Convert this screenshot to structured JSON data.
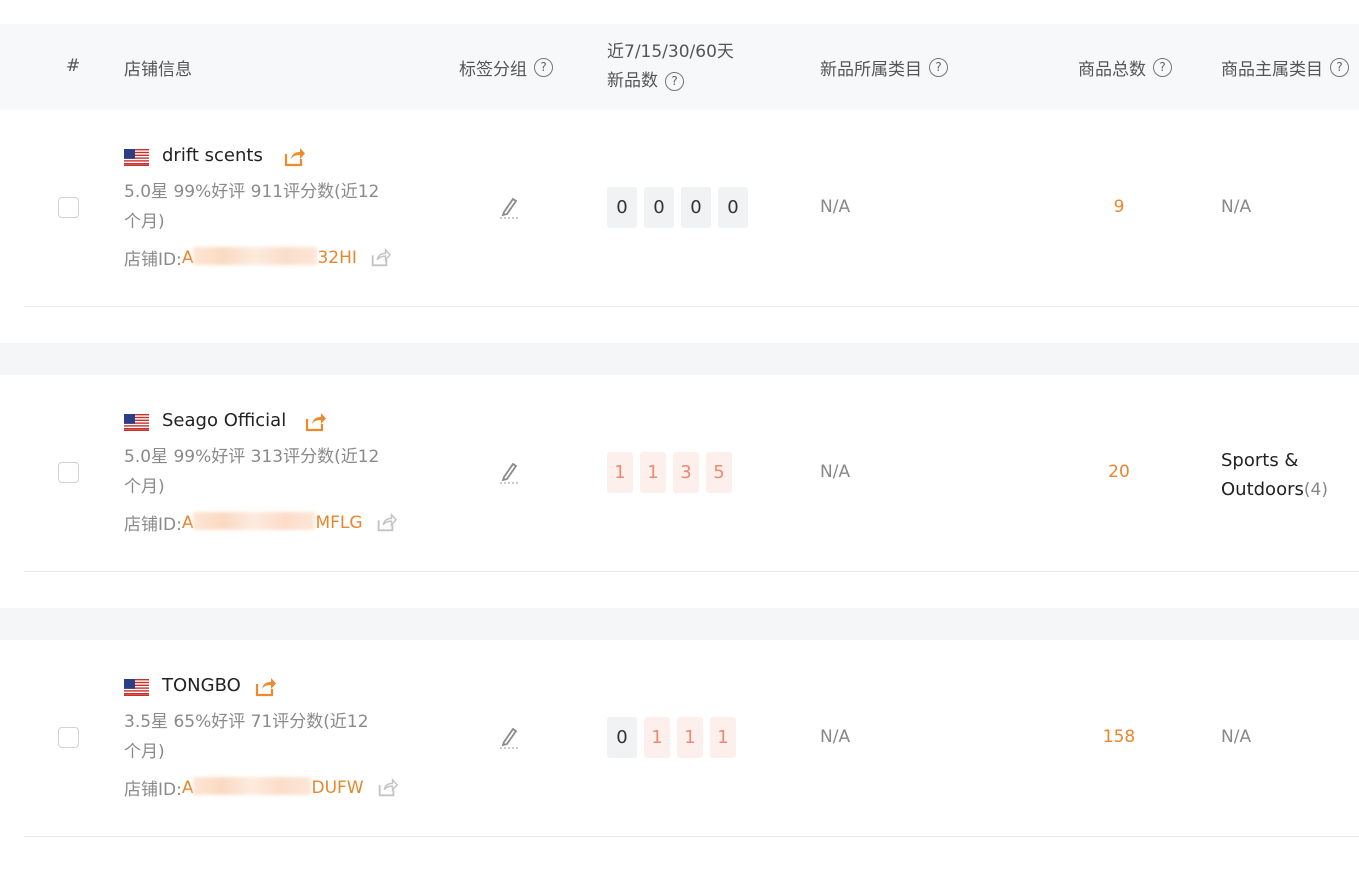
{
  "columns": {
    "index": "#",
    "store_info": "店铺信息",
    "tag_group": "标签分组",
    "new_count_line1": "近7/15/30/60天",
    "new_count_line2": "新品数",
    "new_category": "新品所属类目",
    "total_products": "商品总数",
    "main_category": "商品主属类目",
    "help_symbol": "?"
  },
  "rows": [
    {
      "name": "drift scents",
      "meta_line1": "5.0星  99%好评  911评分数(近12",
      "meta_line2": "个月)",
      "id_label": "店铺ID: ",
      "id_prefix": "A",
      "id_suffix": "32HI",
      "counts": [
        "0",
        "0",
        "0",
        "0"
      ],
      "new_category": "N/A",
      "total": "9",
      "main_category": "N/A",
      "main_category_count": ""
    },
    {
      "name": "Seago Official",
      "meta_line1": "5.0星  99%好评  313评分数(近12",
      "meta_line2": "个月)",
      "id_label": "店铺ID: ",
      "id_prefix": "A",
      "id_suffix": "MFLG",
      "counts": [
        "1",
        "1",
        "3",
        "5"
      ],
      "new_category": "N/A",
      "total": "20",
      "main_category_line1": "Sports &",
      "main_category_line2": "Outdoors",
      "main_category_count": "(4)"
    },
    {
      "name": "TONGBO",
      "meta_line1": "3.5星  65%好评  71评分数(近12",
      "meta_line2": "个月)",
      "id_label": "店铺ID: ",
      "id_prefix": "A",
      "id_suffix": "DUFW",
      "counts": [
        "0",
        "1",
        "1",
        "1"
      ],
      "new_category": "N/A",
      "total": "158",
      "main_category": "N/A",
      "main_category_count": ""
    }
  ],
  "colors": {
    "accent_orange": "#e8862d",
    "positive_count": "#ef8a72",
    "header_bg": "#f7f8fa"
  },
  "icons": {
    "external_link": "external-link-icon",
    "pencil": "pencil-icon",
    "flag": "us-flag-icon",
    "help": "help-circle-icon"
  }
}
